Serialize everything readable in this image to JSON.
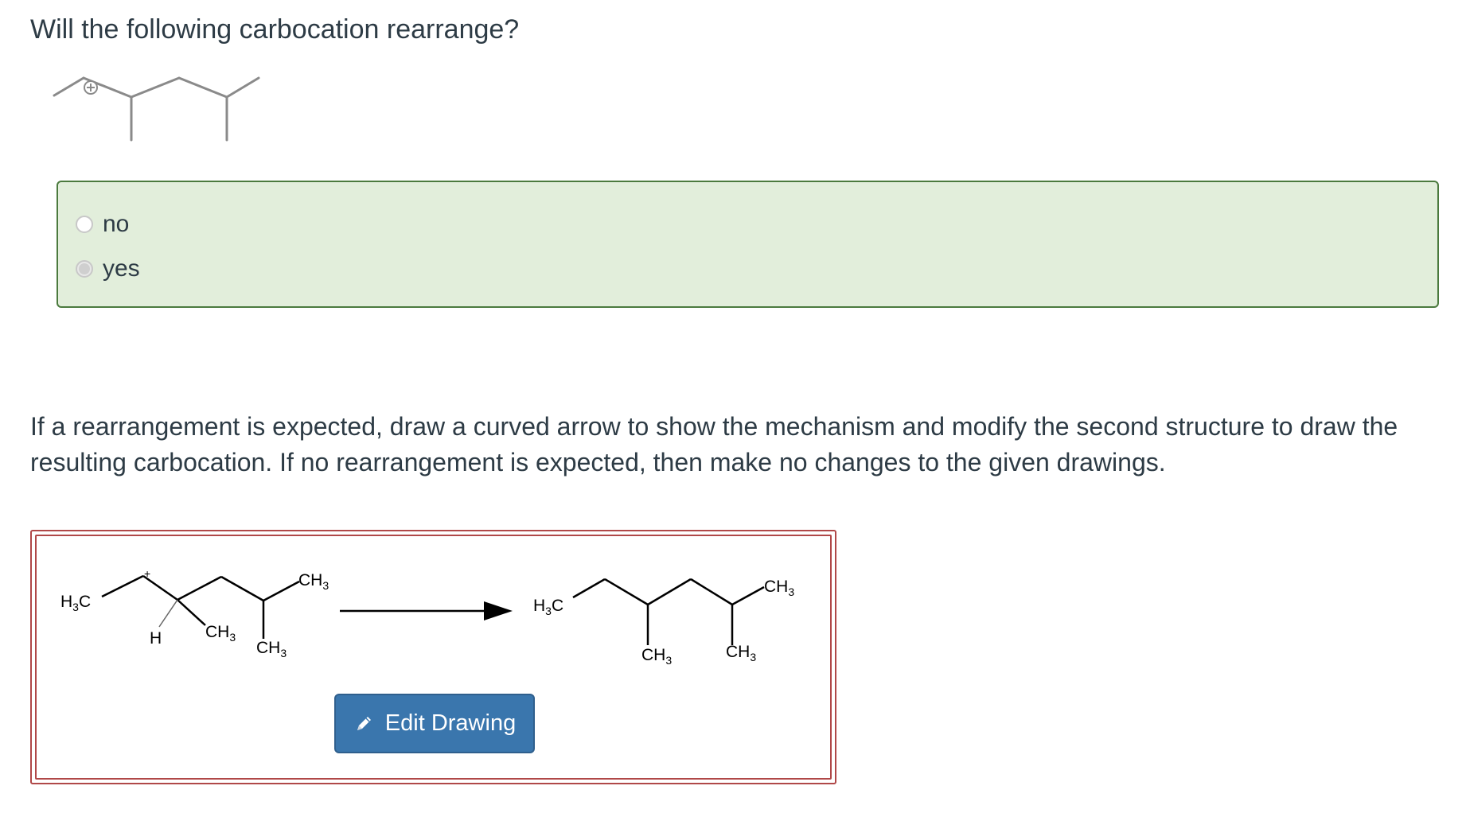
{
  "question": {
    "prompt": "Will the following carbocation rearrange?",
    "options": [
      {
        "label": "no",
        "selected": false
      },
      {
        "label": "yes",
        "selected": true
      }
    ]
  },
  "instructions": "If a rearrangement is expected, draw a curved arrow to show the mechanism and modify the second structure to draw the resulting carbocation. If no rearrangement is expected, then make no changes to the given drawings.",
  "drawing": {
    "charge_symbol": "+",
    "reactant_labels": {
      "h3c": "H3C",
      "h": "H",
      "ch3_a": "CH3",
      "ch3_b": "CH3",
      "ch3_top": "CH3"
    },
    "product_labels": {
      "h3c": "H3C",
      "ch3_a": "CH3",
      "ch3_b": "CH3",
      "ch3_top": "CH3"
    },
    "edit_button_label": "Edit Drawing"
  },
  "colors": {
    "answer_bg": "#e2eedb",
    "answer_border": "#4b7a3e",
    "drawing_border": "#b04848",
    "button_bg": "#3a76ad"
  }
}
